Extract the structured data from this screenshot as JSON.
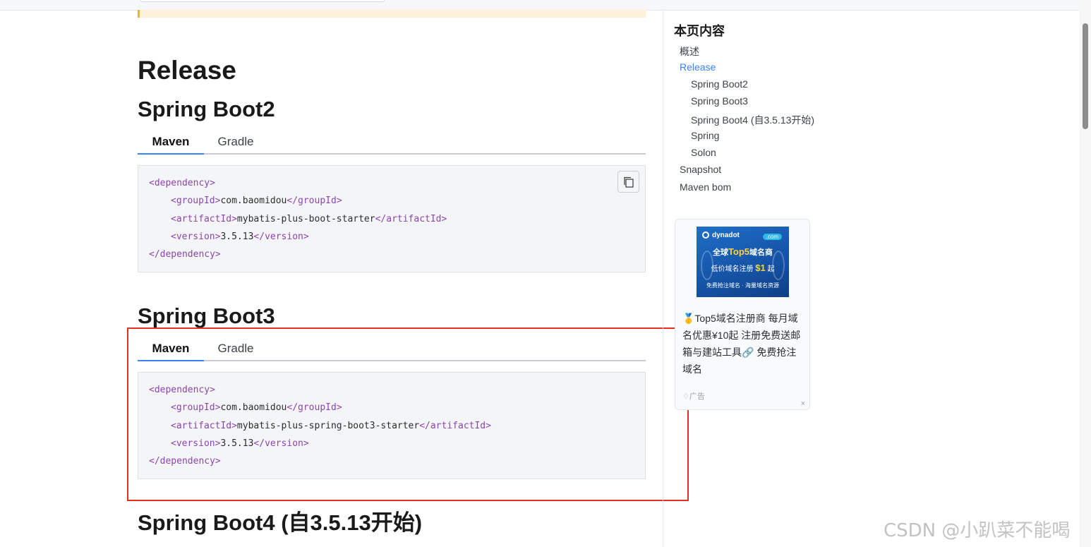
{
  "main": {
    "release_heading": "Release",
    "sections": [
      {
        "heading": "Spring Boot2",
        "tabs": [
          "Maven",
          "Gradle"
        ],
        "active_tab": "Maven",
        "code": {
          "l1_open": "<dependency>",
          "l2_open": "<groupId>",
          "l2_val": "com.baomidou",
          "l2_close": "</groupId>",
          "l3_open": "<artifactId>",
          "l3_val": "mybatis-plus-boot-starter",
          "l3_close": "</artifactId>",
          "l4_open": "<version>",
          "l4_val": "3.5.13",
          "l4_close": "</version>",
          "l5_close": "</dependency>"
        }
      },
      {
        "heading": "Spring Boot3",
        "tabs": [
          "Maven",
          "Gradle"
        ],
        "active_tab": "Maven",
        "code": {
          "l1_open": "<dependency>",
          "l2_open": "<groupId>",
          "l2_val": "com.baomidou",
          "l2_close": "</groupId>",
          "l3_open": "<artifactId>",
          "l3_val": "mybatis-plus-spring-boot3-starter",
          "l3_close": "</artifactId>",
          "l4_open": "<version>",
          "l4_val": "3.5.13",
          "l4_close": "</version>",
          "l5_close": "</dependency>"
        }
      },
      {
        "heading": "Spring Boot4 (自3.5.13开始)"
      }
    ]
  },
  "toc": {
    "title": "本页内容",
    "items": [
      {
        "label": "概述",
        "level": 1
      },
      {
        "label": "Release",
        "level": 1,
        "active": true
      },
      {
        "label": "Spring Boot2",
        "level": 2
      },
      {
        "label": "Spring Boot3",
        "level": 2
      },
      {
        "label": "Spring Boot4 (自3.5.13开始)",
        "level": 2
      },
      {
        "label": "Spring",
        "level": 2
      },
      {
        "label": "Solon",
        "level": 2
      },
      {
        "label": "Snapshot",
        "level": 1
      },
      {
        "label": "Maven bom",
        "level": 1
      }
    ]
  },
  "ad": {
    "brand": "dynadot",
    "badge": ".com",
    "img_line1_a": "全球",
    "img_line1_b": "Top5",
    "img_line1_c": "域名商",
    "img_line2_a": "低价域名注册",
    "img_line2_b": "$1",
    "img_line2_c": "起",
    "img_line3": "免费抢注域名 · 海量域名资源",
    "text": "🥇Top5域名注册商 每月域名优惠¥10起 注册免费送邮箱与建站工具🔗 免费抢注域名",
    "footer": "广告",
    "close": "×"
  },
  "watermark": "CSDN @小趴菜不能喝",
  "colors": {
    "accent": "#3b82f6",
    "xml_tag": "#8e44ad",
    "highlight_border": "#e0301e",
    "warning_bg": "#fdf1d9"
  },
  "icons": {
    "copy": "copy-icon"
  }
}
